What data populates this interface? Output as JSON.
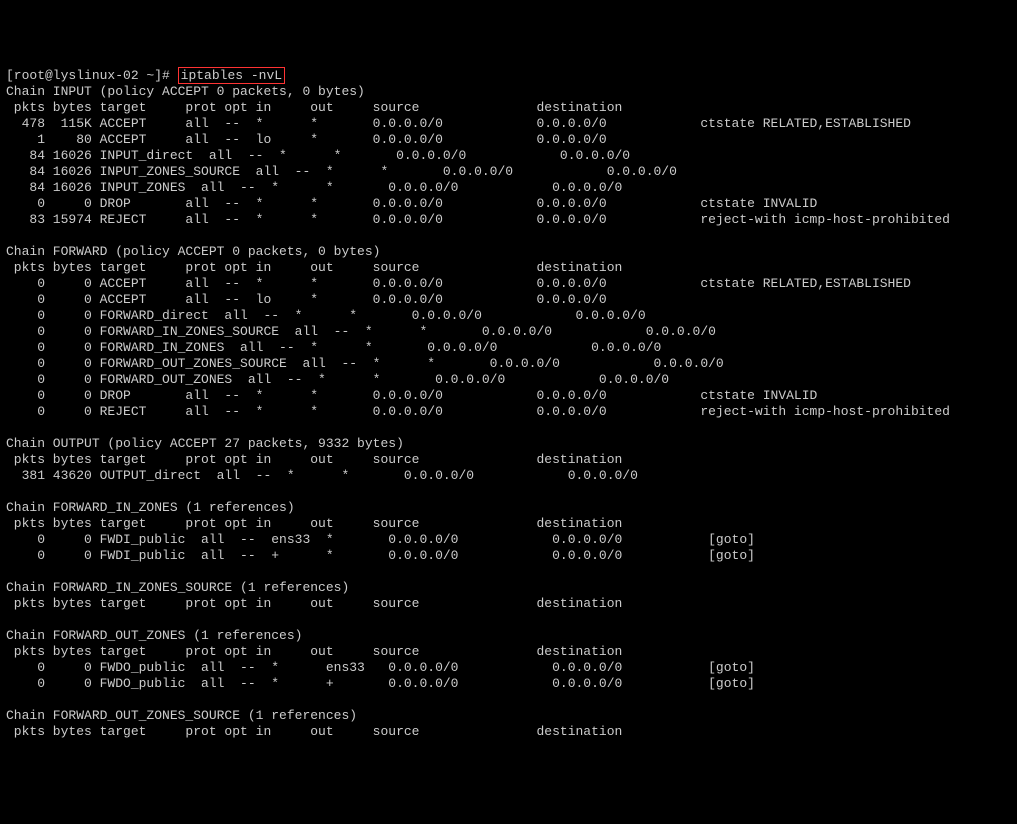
{
  "prompt": "[root@lyslinux-02 ~]# ",
  "command": "iptables -nvL",
  "lines": [
    "Chain INPUT (policy ACCEPT 0 packets, 0 bytes)",
    " pkts bytes target     prot opt in     out     source               destination",
    "  478  115K ACCEPT     all  --  *      *       0.0.0.0/0            0.0.0.0/0            ctstate RELATED,ESTABLISHED",
    "    1    80 ACCEPT     all  --  lo     *       0.0.0.0/0            0.0.0.0/0",
    "   84 16026 INPUT_direct  all  --  *      *       0.0.0.0/0            0.0.0.0/0",
    "   84 16026 INPUT_ZONES_SOURCE  all  --  *      *       0.0.0.0/0            0.0.0.0/0",
    "   84 16026 INPUT_ZONES  all  --  *      *       0.0.0.0/0            0.0.0.0/0",
    "    0     0 DROP       all  --  *      *       0.0.0.0/0            0.0.0.0/0            ctstate INVALID",
    "   83 15974 REJECT     all  --  *      *       0.0.0.0/0            0.0.0.0/0            reject-with icmp-host-prohibited",
    "",
    "Chain FORWARD (policy ACCEPT 0 packets, 0 bytes)",
    " pkts bytes target     prot opt in     out     source               destination",
    "    0     0 ACCEPT     all  --  *      *       0.0.0.0/0            0.0.0.0/0            ctstate RELATED,ESTABLISHED",
    "    0     0 ACCEPT     all  --  lo     *       0.0.0.0/0            0.0.0.0/0",
    "    0     0 FORWARD_direct  all  --  *      *       0.0.0.0/0            0.0.0.0/0",
    "    0     0 FORWARD_IN_ZONES_SOURCE  all  --  *      *       0.0.0.0/0            0.0.0.0/0",
    "    0     0 FORWARD_IN_ZONES  all  --  *      *       0.0.0.0/0            0.0.0.0/0",
    "    0     0 FORWARD_OUT_ZONES_SOURCE  all  --  *      *       0.0.0.0/0            0.0.0.0/0",
    "    0     0 FORWARD_OUT_ZONES  all  --  *      *       0.0.0.0/0            0.0.0.0/0",
    "    0     0 DROP       all  --  *      *       0.0.0.0/0            0.0.0.0/0            ctstate INVALID",
    "    0     0 REJECT     all  --  *      *       0.0.0.0/0            0.0.0.0/0            reject-with icmp-host-prohibited",
    "",
    "Chain OUTPUT (policy ACCEPT 27 packets, 9332 bytes)",
    " pkts bytes target     prot opt in     out     source               destination",
    "  381 43620 OUTPUT_direct  all  --  *      *       0.0.0.0/0            0.0.0.0/0",
    "",
    "Chain FORWARD_IN_ZONES (1 references)",
    " pkts bytes target     prot opt in     out     source               destination",
    "    0     0 FWDI_public  all  --  ens33  *       0.0.0.0/0            0.0.0.0/0           [goto]",
    "    0     0 FWDI_public  all  --  +      *       0.0.0.0/0            0.0.0.0/0           [goto]",
    "",
    "Chain FORWARD_IN_ZONES_SOURCE (1 references)",
    " pkts bytes target     prot opt in     out     source               destination",
    "",
    "Chain FORWARD_OUT_ZONES (1 references)",
    " pkts bytes target     prot opt in     out     source               destination",
    "    0     0 FWDO_public  all  --  *      ens33   0.0.0.0/0            0.0.0.0/0           [goto]",
    "    0     0 FWDO_public  all  --  *      +       0.0.0.0/0            0.0.0.0/0           [goto]",
    "",
    "Chain FORWARD_OUT_ZONES_SOURCE (1 references)",
    " pkts bytes target     prot opt in     out     source               destination"
  ]
}
